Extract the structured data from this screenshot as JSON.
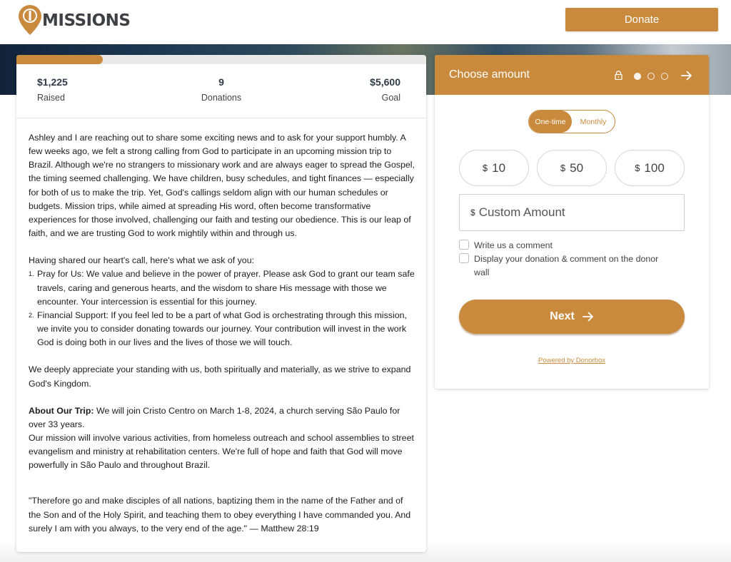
{
  "brand": {
    "logo_text": "MISSIONS",
    "accent": "#c98a3d"
  },
  "header": {
    "donate_label": "Donate"
  },
  "campaign": {
    "progress_fraction": 0.21,
    "raised_value": "$1,225",
    "raised_label": "Raised",
    "donations_value": "9",
    "donations_label": "Donations",
    "goal_value": "$5,600",
    "goal_label": "Goal"
  },
  "story": {
    "intro": "Ashley and I are reaching out to share some exciting news and to ask for your support humbly. A few weeks ago, we felt a strong calling from God to participate in an upcoming mission trip to Brazil. Although we're no strangers to missionary work and are always eager to spread the Gospel, the timing seemed challenging. We have children, busy schedules, and tight finances — especially for both of us to make the trip. Yet, God's callings seldom align with our human schedules or budgets. Mission trips, while aimed at spreading His word, often become transformative experiences for those involved, challenging our faith and testing our obedience. This is our leap of faith, and we are trusting God to work mightily within and through us.",
    "ask_heading": "Having shared our heart's call, here's what we ask of you:",
    "asks": [
      {
        "num": "1.",
        "text": "Pray for Us: We value and believe in the power of prayer. Please ask God to grant our team safe travels, caring and generous hearts, and the wisdom to share His message with those we encounter. Your intercession is essential for this journey."
      },
      {
        "num": "2.",
        "text": "Financial Support: If you feel led to be a part of what God is orchestrating through this mission, we invite you to consider donating towards our journey. Your contribution will invest in the work God is doing both in our lives and the lives of those we will touch."
      }
    ],
    "appreciation": "We deeply appreciate your standing with us, both spiritually and materially, as we strive to expand God's Kingdom.",
    "trip_heading": "About Our Trip:",
    "trip_text": " We will join Cristo Centro on March 1-8, 2024, a church serving São Paulo for over 33 years.",
    "mission_text": "Our mission will involve various activities, from homeless outreach and school assemblies to street evangelism and ministry at rehabilitation centers. We're full of hope and faith that God will move powerfully in São Paulo and throughout Brazil.",
    "quote": "\"Therefore go and make disciples of all nations, baptizing them in the name of the Father and of the Son and of the Holy Spirit, and teaching them to obey everything I have commanded you. And surely I am with you always, to the very end of the age.\" — Matthew 28:19"
  },
  "widget": {
    "title": "Choose amount",
    "step_current": 1,
    "step_total": 3,
    "frequency": {
      "one_time": "One-time",
      "monthly": "Monthly",
      "selected": "One-time"
    },
    "currency": "$",
    "amounts": [
      "10",
      "50",
      "100"
    ],
    "custom_placeholder": "Custom Amount",
    "comment_label": "Write us a comment",
    "display_label": "Display your donation & comment on the donor wall",
    "next_label": "Next",
    "powered_by": "Powered by Donorbox"
  }
}
